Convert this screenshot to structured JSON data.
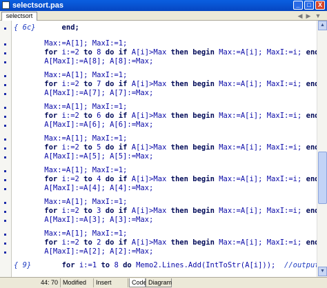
{
  "window": {
    "title": "selectsort.pas",
    "min": "_",
    "max": "□",
    "close": "X"
  },
  "tabs": {
    "file_tab": "selectsort",
    "back": "◀",
    "forward": "▶",
    "dropdown": "▼"
  },
  "scrollbar": {
    "up": "▲",
    "down": "▼"
  },
  "status": {
    "position": "44: 70",
    "modified": "Modified",
    "mode": "Insert",
    "tab_code": "Code",
    "tab_diagram": "Diagram"
  },
  "code": {
    "l0_cmt": "{ 6c}",
    "l0_end": "end;",
    "b1": {
      "l1": "Max:=A[1]; MaxI:=1;",
      "for": "for",
      "i": " i:=",
      "from": "2",
      "to": " to ",
      "upto": "8",
      "do": " do ",
      "if": "if",
      "cond": " A[i]>Max ",
      "then": "then",
      "begin": "begin",
      "body": " Max:=A[i]; MaxI:=i; ",
      "end": "end;",
      "l3": "A[MaxI]:=A[8]; A[8]:=Max;"
    },
    "b2": {
      "l1": "Max:=A[1]; MaxI:=1;",
      "upto": "7",
      "l3": "A[MaxI]:=A[7]; A[7]:=Max;"
    },
    "b3": {
      "l1": "Max:=A[1]; MaxI:=1;",
      "upto": "6",
      "l3": "A[MaxI]:=A[6]; A[6]:=Max;"
    },
    "b4": {
      "l1": "Max:=A[1]; MaxI:=1;",
      "upto": "5",
      "l3": "A[MaxI]:=A[5]; A[5]:=Max;"
    },
    "b5": {
      "l1": "Max:=A[1]; MaxI:=1;",
      "upto": "4",
      "l3": "A[MaxI]:=A[4]; A[4]:=Max;"
    },
    "b6": {
      "l1": "Max:=A[1]; MaxI:=1;",
      "upto": "3",
      "l3": "A[MaxI]:=A[3]; A[3]:=Max;"
    },
    "b7": {
      "l1": "Max:=A[1]; MaxI:=1;",
      "upto": "2",
      "l3": "A[MaxI]:=A[2]; A[2]:=Max;"
    },
    "last": {
      "cmt": "{ 9}",
      "for": "for",
      "i": " i:=",
      "from": "1",
      "to": " to ",
      "upto": "8",
      "do": " do ",
      "rest": "Memo2.Lines.Add(IntToStr(A[i]));",
      "comment": "  //output"
    }
  }
}
